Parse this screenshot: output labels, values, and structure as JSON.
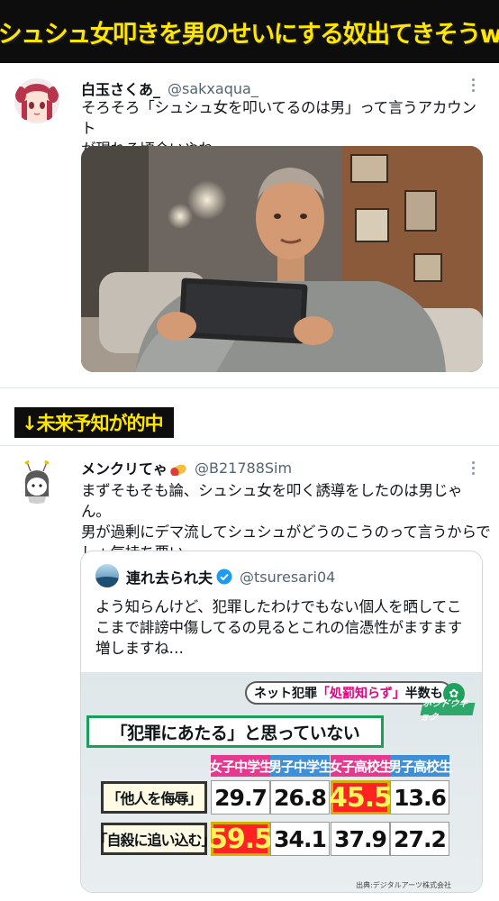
{
  "banner": {
    "title": "シュシュ女叩きを男のせいにする奴出てきそうw"
  },
  "tweet1": {
    "display_name": "白玉さくあ_",
    "handle": "@sakxaqua_",
    "text": "そろそろ「シュシュ女を叩いてるのは男」って言うアカウント\nが現れる頃合いやね"
  },
  "prediction": {
    "label": "↓未来予知が的中"
  },
  "tweet2": {
    "display_name": "メンクリてゃ",
    "handle": "@B21788Sim",
    "text": "まずそもそも論、シュシュ女を叩く誘導をしたのは男じゃん。\n男が過剰にデマ流してシュシュがどうのこうのって言うからで\nしょ気持ち悪い"
  },
  "quote": {
    "display_name": "連れ去られ夫",
    "handle": "@tsuresari04",
    "text": "よう知らんけど、犯罪したわけでもない個人を晒してこ\nこまで誹謗中傷してるの見るとこれの信憑性がますます\n増しますね…"
  },
  "tv": {
    "header_prefix": "ネット犯罪",
    "header_highlight": "「処罰知らず」",
    "header_suffix": "半数も",
    "logo": "ホウドウキョク",
    "subtitle": "「犯罪にあたる」と思っていない",
    "columns": [
      {
        "label": "女子中学生",
        "color": "#e4398f"
      },
      {
        "label": "男子中学生",
        "color": "#3f8fd6"
      },
      {
        "label": "女子高校生",
        "color": "#e4398f"
      },
      {
        "label": "男子高校生",
        "color": "#3f8fd6"
      }
    ],
    "rows": [
      {
        "label": "「他人を侮辱」",
        "values": [
          "29.7",
          "26.8",
          "45.5",
          "13.6"
        ]
      },
      {
        "label": "「自殺に追い込む」",
        "values": [
          "59.5",
          "34.1",
          "37.9",
          "27.2"
        ]
      }
    ],
    "source": "出典:デジタルアーツ株式会社"
  },
  "colors": {
    "banner_bg": "#0d0d0d",
    "banner_text": "#ffe600",
    "handle": "#536471",
    "highlight_cell": "#ff2222"
  }
}
